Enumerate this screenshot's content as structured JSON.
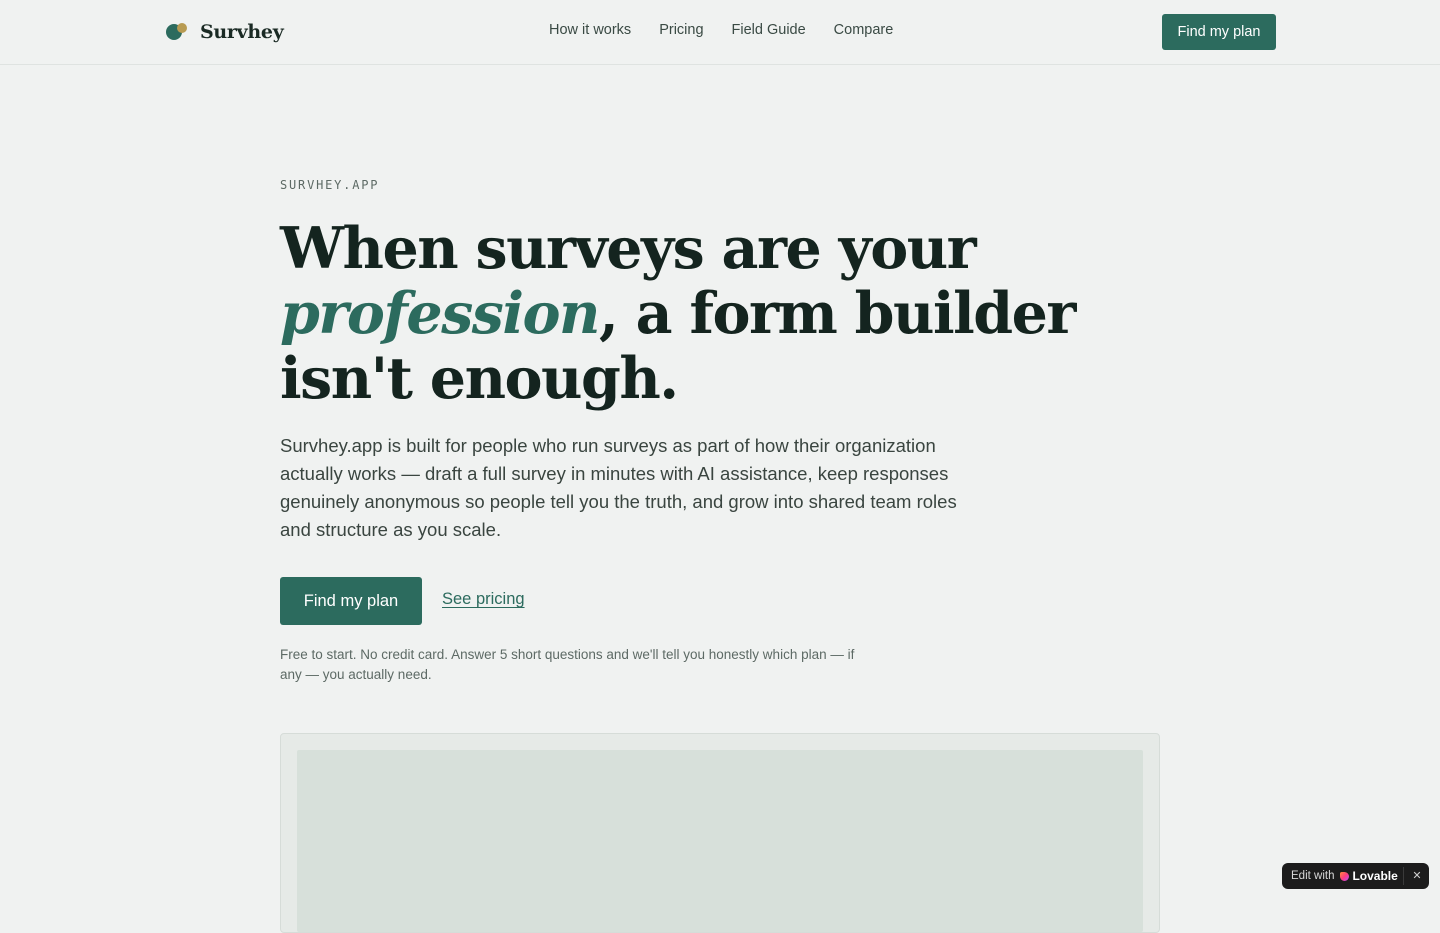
{
  "header": {
    "brand_name": "Survhey",
    "nav": [
      {
        "label": "How it works"
      },
      {
        "label": "Pricing"
      },
      {
        "label": "Field Guide"
      },
      {
        "label": "Compare"
      }
    ],
    "cta_label": "Find my plan"
  },
  "hero": {
    "eyebrow": "SURVHEY.APP",
    "headline_line1": "When surveys are your",
    "headline_accent": "profession",
    "headline_rest": ", a form builder isn't enough.",
    "lede": "Survhey.app is built for people who run surveys as part of how their organization actually works — draft a full survey in minutes with AI assistance, keep responses genuinely anonymous so people tell you the truth, and grow into shared team roles and structure as you scale.",
    "cta_label": "Find my plan",
    "pricing_link": "See pricing",
    "fineprint": "Free to start. No credit card. Answer 5 short questions and we'll tell you honestly which plan — if any — you actually need."
  },
  "badge": {
    "edit_text": "Edit with",
    "brand_text": "Lovable",
    "close_icon": "close-icon"
  },
  "colors": {
    "accent": "#2c6b5e",
    "logo_gold": "#b89b52",
    "background": "#f0f2f1"
  }
}
